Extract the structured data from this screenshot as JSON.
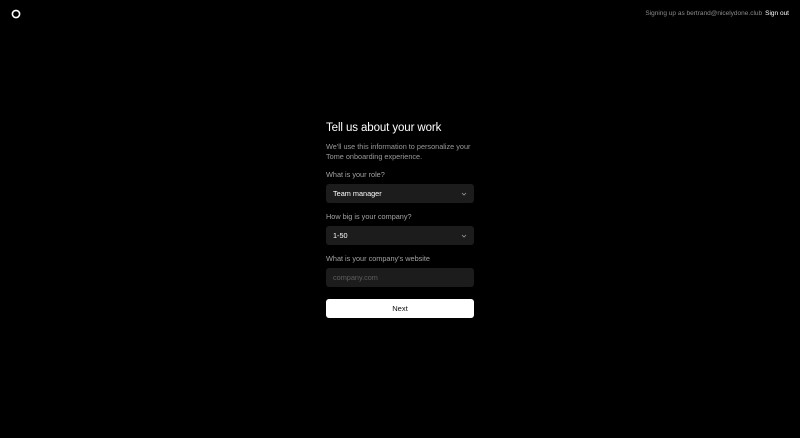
{
  "header": {
    "logo_icon": "ring-logo-icon",
    "signing_text": "Signing up as bertrand@nicelydone.club",
    "sign_out_label": "Sign out"
  },
  "form": {
    "title": "Tell us about your work",
    "subtitle": "We'll use this information to personalize your Tome onboarding experience.",
    "role": {
      "label": "What is your role?",
      "value": "Team manager",
      "icon": "chevron-down-icon"
    },
    "company_size": {
      "label": "How big is your company?",
      "value": "1-50",
      "icon": "chevron-down-icon"
    },
    "website": {
      "label": "What is your company's website",
      "placeholder": "company.com",
      "value": ""
    },
    "next_label": "Next"
  },
  "colors": {
    "background": "#000000",
    "field_background": "#1c1c1c",
    "muted_text": "#8a8a8a",
    "button_background": "#ffffff"
  }
}
